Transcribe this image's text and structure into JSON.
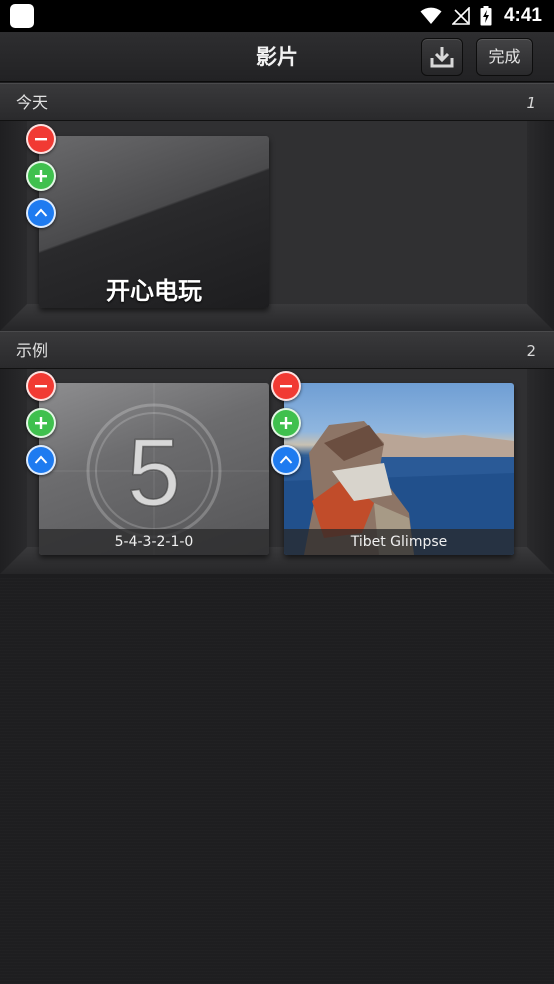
{
  "status_bar": {
    "time": "4:41"
  },
  "title_bar": {
    "title": "影片",
    "download_icon": "download-tray-icon",
    "done_label": "完成"
  },
  "sections": [
    {
      "name": "今天",
      "count": "1",
      "items": [
        {
          "title": "开心电玩",
          "caption": ""
        }
      ]
    },
    {
      "name": "示例",
      "count": "2",
      "items": [
        {
          "countdown_number": "5",
          "caption": "5-4-3-2-1-0"
        },
        {
          "caption": "Tibet Glimpse"
        }
      ]
    }
  ],
  "item_actions": {
    "delete_icon": "minus-icon",
    "add_icon": "plus-icon",
    "share_icon": "chevron-up-icon"
  },
  "colors": {
    "delete": "#f13a33",
    "add": "#3fc04e",
    "share": "#1e7bf0"
  }
}
